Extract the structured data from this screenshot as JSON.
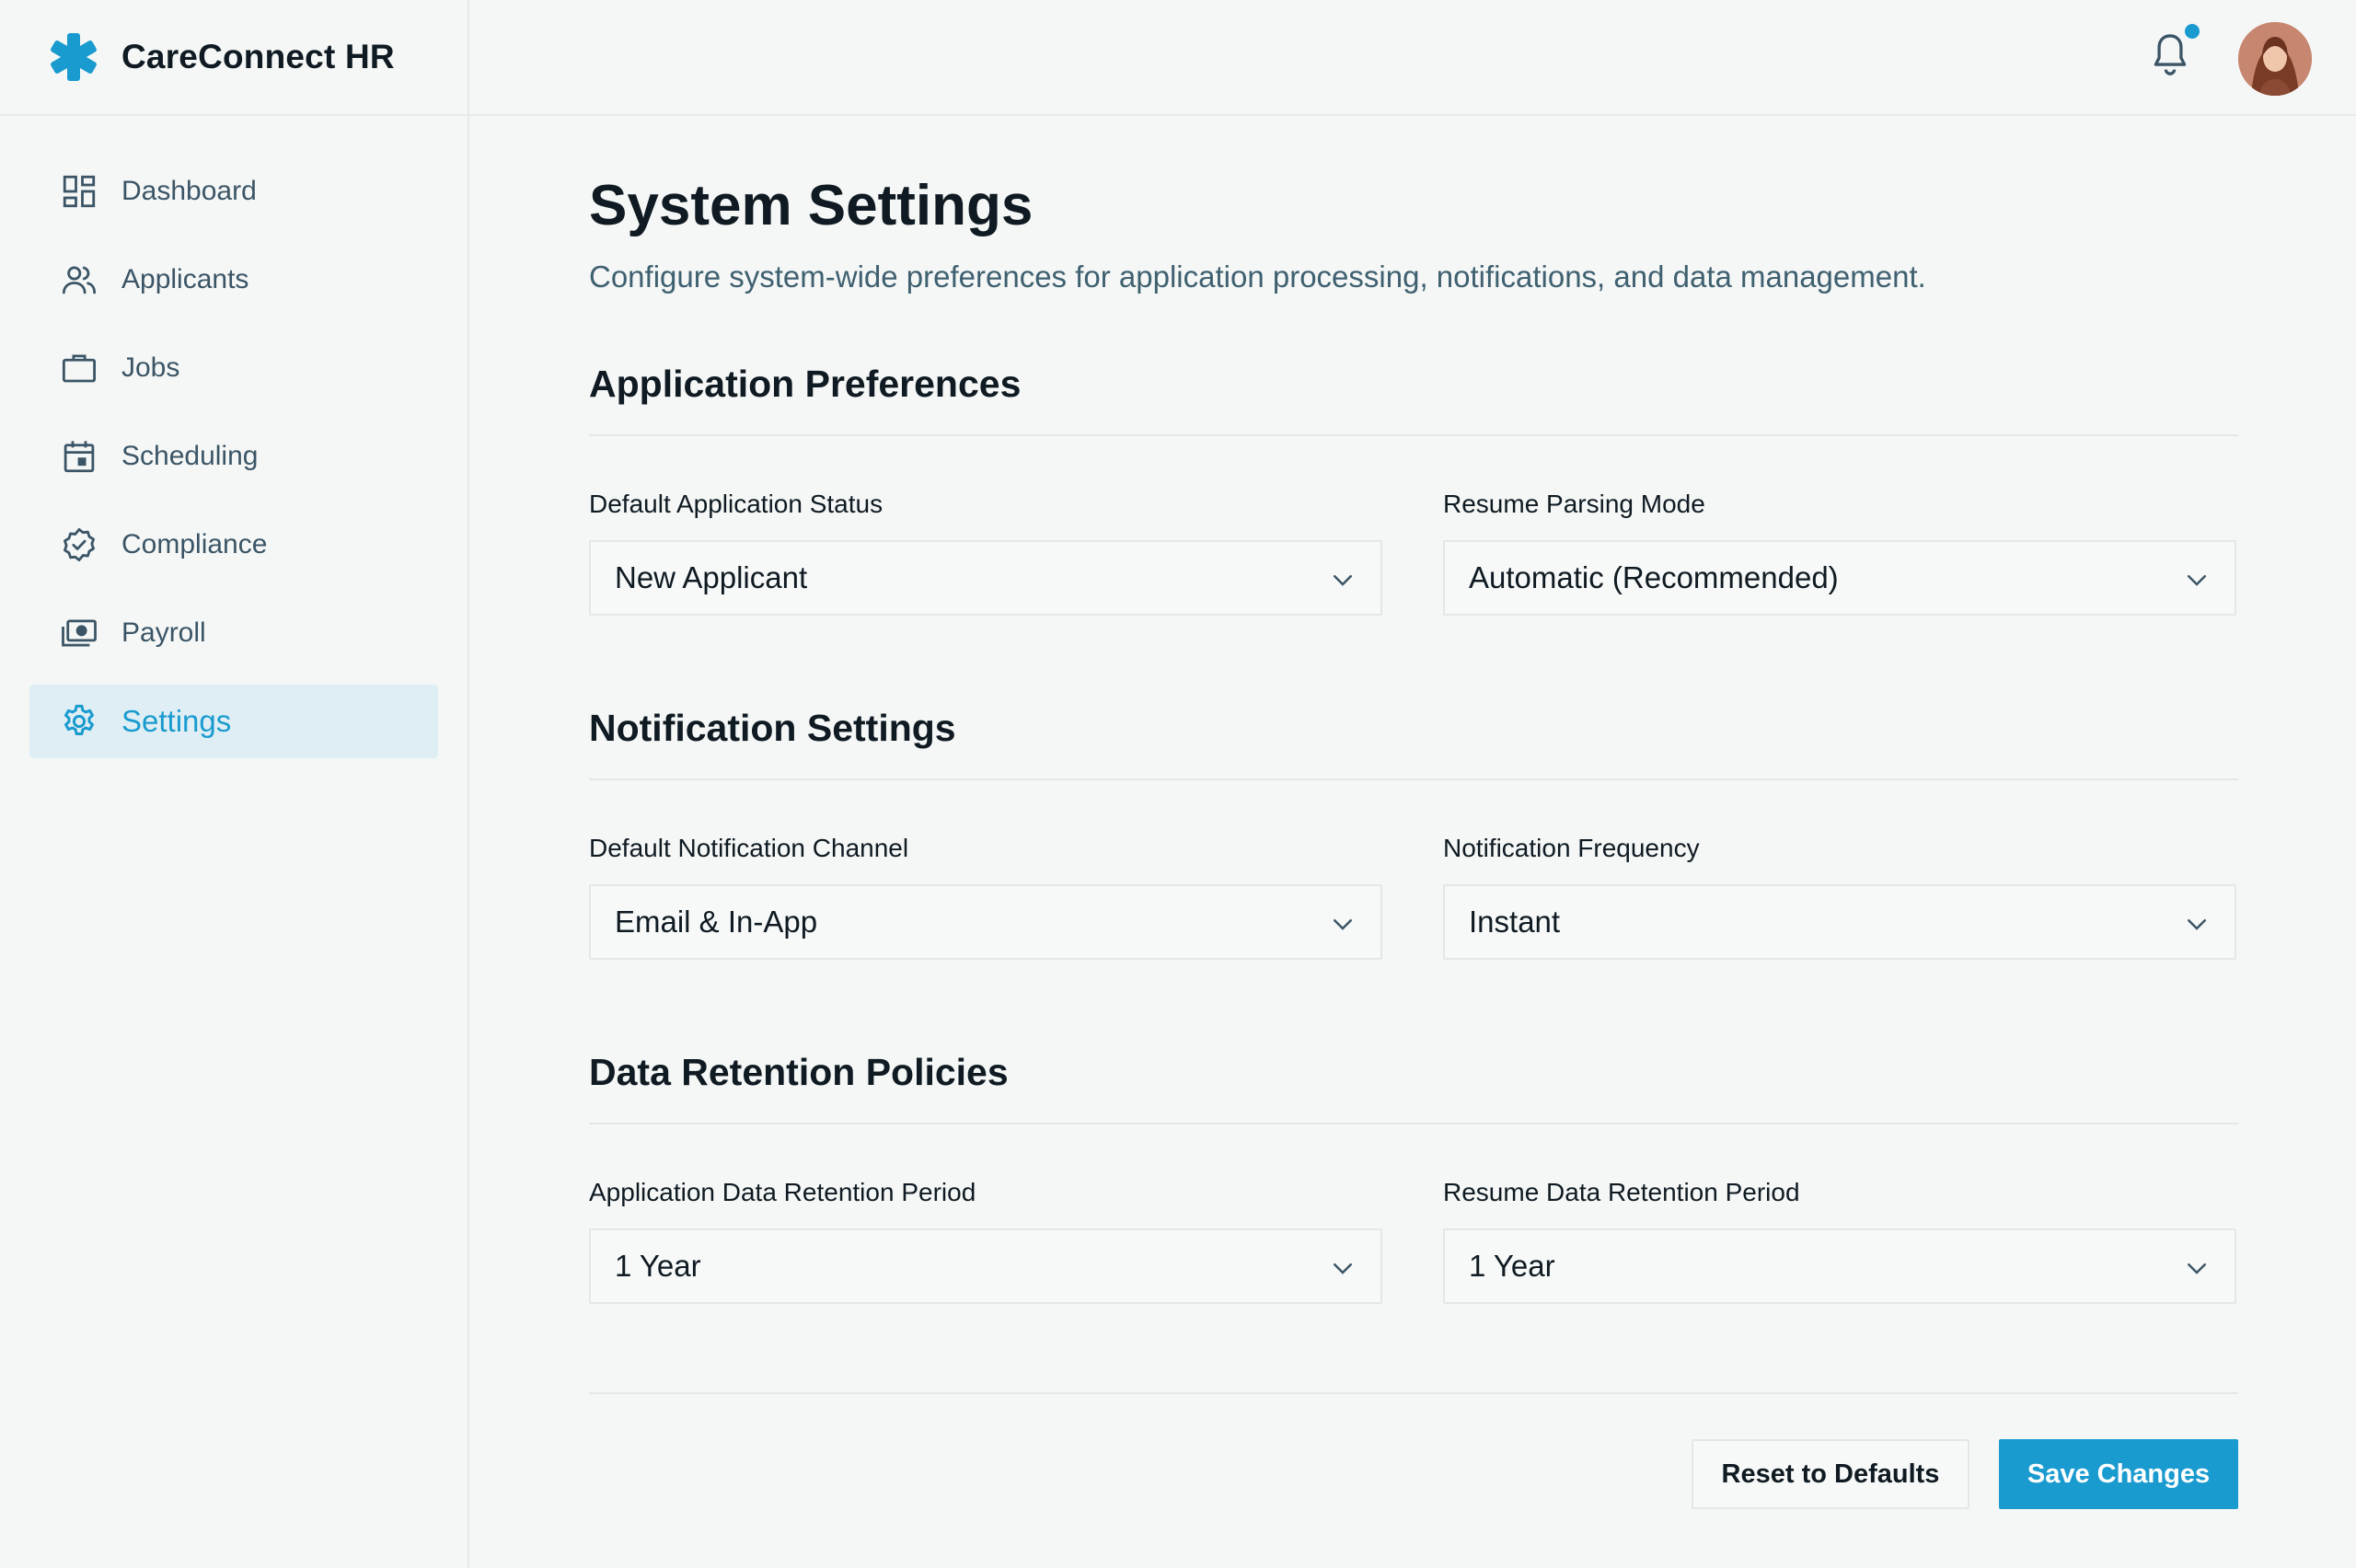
{
  "brand": {
    "name": "CareConnect HR",
    "logo_icon": "asterisk-icon",
    "accent_color": "#1a9bcf"
  },
  "sidebar": {
    "items": [
      {
        "label": "Dashboard",
        "icon": "dashboard-icon",
        "active": false
      },
      {
        "label": "Applicants",
        "icon": "users-icon",
        "active": false
      },
      {
        "label": "Jobs",
        "icon": "briefcase-icon",
        "active": false
      },
      {
        "label": "Scheduling",
        "icon": "calendar-icon",
        "active": false
      },
      {
        "label": "Compliance",
        "icon": "badge-check-icon",
        "active": false
      },
      {
        "label": "Payroll",
        "icon": "cash-icon",
        "active": false
      },
      {
        "label": "Settings",
        "icon": "gear-icon",
        "active": true
      }
    ]
  },
  "topbar": {
    "notification_icon": "bell-icon",
    "has_unread": true,
    "avatar": "user-avatar"
  },
  "page": {
    "title": "System Settings",
    "subtitle": "Configure system-wide preferences for application processing, notifications, and data management."
  },
  "sections": [
    {
      "title": "Application Preferences",
      "fields": [
        {
          "label": "Default Application Status",
          "value": "New Applicant"
        },
        {
          "label": "Resume Parsing Mode",
          "value": "Automatic (Recommended)"
        }
      ]
    },
    {
      "title": "Notification Settings",
      "fields": [
        {
          "label": "Default Notification Channel",
          "value": "Email & In-App"
        },
        {
          "label": "Notification Frequency",
          "value": "Instant"
        }
      ]
    },
    {
      "title": "Data Retention Policies",
      "fields": [
        {
          "label": "Application Data Retention Period",
          "value": "1 Year"
        },
        {
          "label": "Resume Data Retention Period",
          "value": "1 Year"
        }
      ]
    }
  ],
  "actions": {
    "reset_label": "Reset to Defaults",
    "save_label": "Save Changes"
  }
}
